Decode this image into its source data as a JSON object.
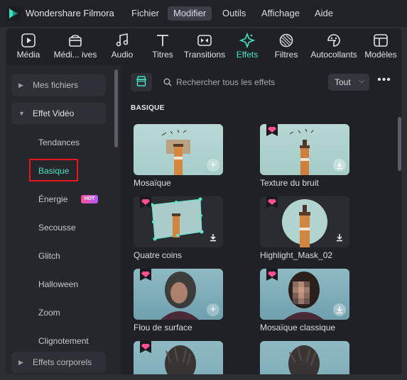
{
  "app": {
    "title": "Wondershare Filmora"
  },
  "menu": [
    "Fichier",
    "Modifier",
    "Outils",
    "Affichage",
    "Aide"
  ],
  "menu_active": "Modifier",
  "toolbar": {
    "items": [
      {
        "label": "Média",
        "icon": "media-icon"
      },
      {
        "label": "Médi... ives",
        "icon": "stock-media-icon"
      },
      {
        "label": "Audio",
        "icon": "audio-icon"
      },
      {
        "label": "Titres",
        "icon": "titles-icon"
      },
      {
        "label": "Transitions",
        "icon": "transitions-icon"
      },
      {
        "label": "Effets",
        "icon": "effects-icon"
      },
      {
        "label": "Filtres",
        "icon": "filters-icon"
      },
      {
        "label": "Autocollants",
        "icon": "stickers-icon"
      },
      {
        "label": "Modèles",
        "icon": "templates-icon"
      }
    ],
    "active": "Effets"
  },
  "sidebar": {
    "mes_fichiers": "Mes fichiers",
    "effet_video": "Effet Vidéo",
    "items": [
      "Tendances",
      "Basique",
      "Énergie",
      "Secousse",
      "Glitch",
      "Halloween",
      "Zoom",
      "Clignotement"
    ],
    "selected": "Basique",
    "hot_badge": "HOT",
    "effets_corporels": "Effets corporels"
  },
  "search": {
    "placeholder": "Rechercher tous les effets"
  },
  "filter": {
    "value": "Tout"
  },
  "section": {
    "title": "BASIQUE"
  },
  "effects": [
    {
      "name": "Mosaïque",
      "premium": false,
      "action": "add"
    },
    {
      "name": "Texture du bruit",
      "premium": true,
      "action": "download"
    },
    {
      "name": "Quatre coins",
      "premium": true,
      "action": "download"
    },
    {
      "name": "Highlight_Mask_02",
      "premium": true,
      "action": "download"
    },
    {
      "name": "Flou de surface",
      "premium": true,
      "action": "add"
    },
    {
      "name": "Mosaïque classique",
      "premium": true,
      "action": "download"
    },
    {
      "name": "",
      "premium": true,
      "action": "none"
    },
    {
      "name": "",
      "premium": false,
      "action": "none"
    }
  ],
  "colors": {
    "accent": "#44e3c2",
    "highlight_box": "#e5171c",
    "premium_gem": "#ff4f93"
  }
}
